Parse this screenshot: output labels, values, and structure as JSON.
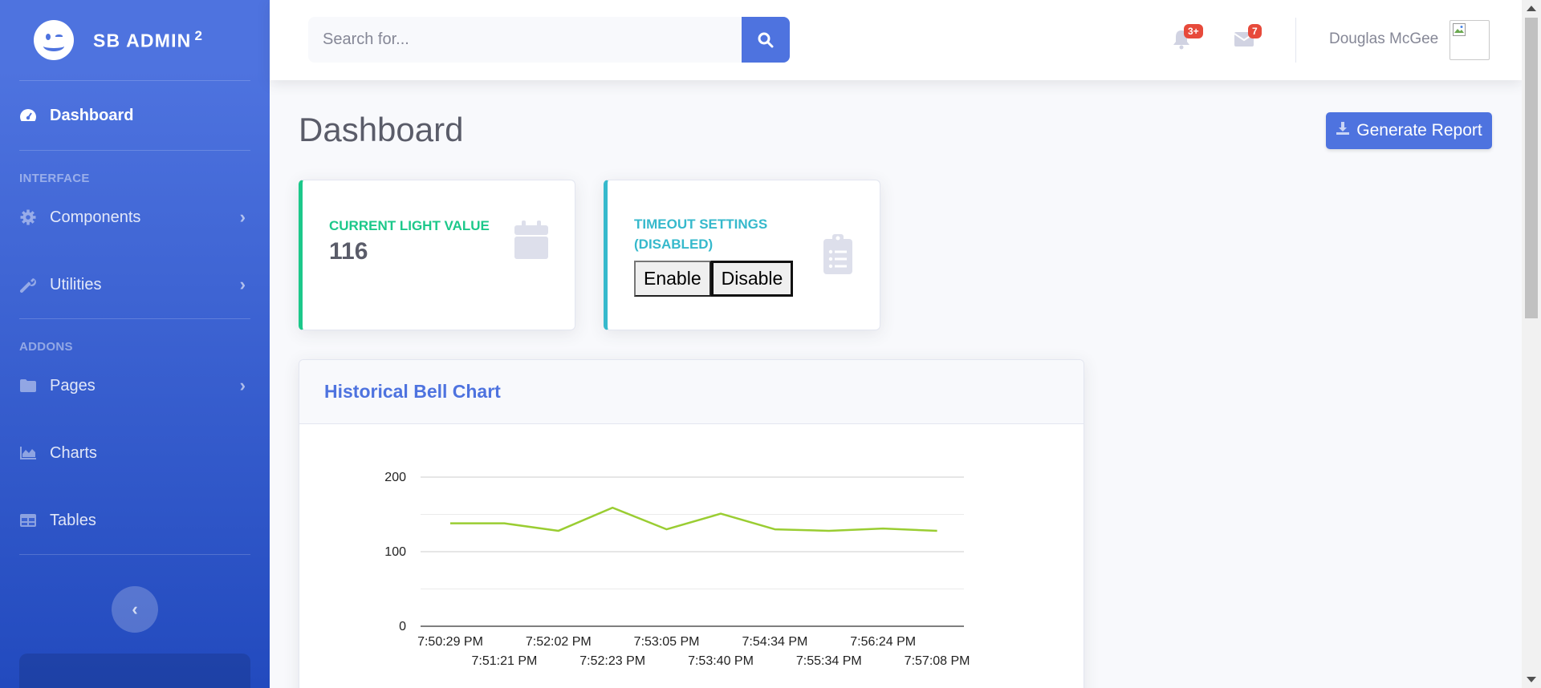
{
  "sidebar": {
    "brand": "SB ADMIN",
    "brand_sup": "2",
    "dashboard": "Dashboard",
    "heading_interface": "Interface",
    "components": "Components",
    "utilities": "Utilities",
    "heading_addons": "Addons",
    "pages": "Pages",
    "charts": "Charts",
    "tables": "Tables"
  },
  "topbar": {
    "search_placeholder": "Search for...",
    "alerts_badge": "3+",
    "messages_badge": "7",
    "username": "Douglas McGee"
  },
  "main": {
    "title": "Dashboard",
    "report_button": "Generate Report",
    "light_card": {
      "label": "Current Light Value",
      "value": "116"
    },
    "timeout_card": {
      "label_line1": "Timeout Settings",
      "label_line2": "(Disabled)",
      "enable": "Enable",
      "disable": "Disable"
    },
    "chart_card_title": "Historical Bell Chart"
  },
  "colors": {
    "primary": "#4e73df",
    "success": "#1cc88a",
    "info": "#36b9cc",
    "danger": "#e74a3b",
    "line": "#9acd32"
  },
  "chart_data": {
    "type": "line",
    "title": "Historical Bell Chart",
    "x": [
      "7:50:29 PM",
      "7:51:21 PM",
      "7:52:02 PM",
      "7:52:23 PM",
      "7:53:05 PM",
      "7:53:40 PM",
      "7:54:34 PM",
      "7:55:34 PM",
      "7:56:24 PM",
      "7:57:08 PM"
    ],
    "series": [
      {
        "values": [
          138,
          138,
          128,
          159,
          130,
          151,
          130,
          128,
          131,
          128
        ]
      }
    ],
    "ylim": [
      0,
      200
    ],
    "yticks": [
      0,
      100,
      200
    ],
    "xlabel": "",
    "ylabel": "",
    "grid": true
  }
}
